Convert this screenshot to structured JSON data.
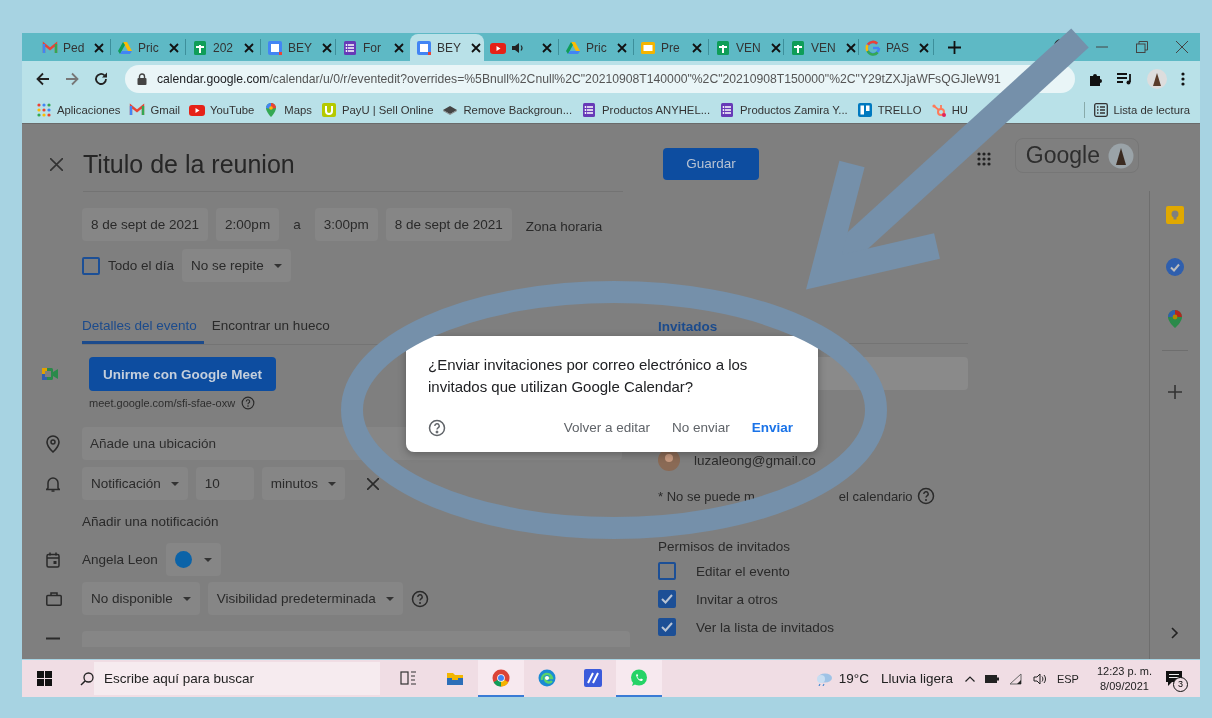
{
  "browser": {
    "tabs": [
      {
        "kind": "gmail",
        "label": "Ped",
        "selected": false
      },
      {
        "kind": "drive",
        "label": "Pric",
        "selected": false
      },
      {
        "kind": "sheets",
        "label": "202",
        "selected": false
      },
      {
        "kind": "calendar",
        "label": "BEY",
        "selected": false
      },
      {
        "kind": "forms",
        "label": "For",
        "selected": false
      },
      {
        "kind": "calendar",
        "label": "BEY",
        "selected": true
      },
      {
        "kind": "youtube",
        "selected": false
      },
      {
        "kind": "drive",
        "label": "Pric",
        "selected": false
      },
      {
        "kind": "slides",
        "label": "Pre",
        "selected": false
      },
      {
        "kind": "sheets",
        "label": "VEN",
        "selected": false
      },
      {
        "kind": "sheets",
        "label": "VEN",
        "selected": false
      },
      {
        "kind": "google",
        "label": "PAS",
        "selected": false
      }
    ],
    "url": {
      "domain": "calendar.google.com",
      "path": "/calendar/u/0/r/eventedit?overrides=%5Bnull%2Cnull%2C\"20210908T140000\"%2C\"20210908T150000\"%2C\"Y29tZXJjaWFsQGJleW91"
    },
    "bookmarks": [
      {
        "kind": "apps",
        "label": "Aplicaciones"
      },
      {
        "kind": "gmail",
        "label": "Gmail"
      },
      {
        "kind": "youtube",
        "label": "YouTube"
      },
      {
        "kind": "maps",
        "label": "Maps"
      },
      {
        "kind": "payu",
        "label": "PayU | Sell Online"
      },
      {
        "kind": "diamond",
        "label": "Remove Backgroun..."
      },
      {
        "kind": "forms",
        "label": "Productos ANYHEL..."
      },
      {
        "kind": "forms",
        "label": "Productos Zamira Y..."
      },
      {
        "kind": "trello",
        "label": "TRELLO"
      },
      {
        "kind": "hubspot",
        "label": "HU"
      }
    ],
    "reading_list": "Lista de lectura"
  },
  "event": {
    "title": "Titulo de la reunion",
    "save": "Guardar",
    "account_logo": "Google",
    "when": [
      {
        "kind": "chip",
        "text": "8 de sept de 2021"
      },
      {
        "kind": "chip",
        "text": "2:00pm"
      },
      {
        "kind": "plain",
        "text": "a"
      },
      {
        "kind": "chip",
        "text": "3:00pm"
      },
      {
        "kind": "chip",
        "text": "8 de sept de 2021"
      },
      {
        "kind": "link",
        "text": "Zona horaria"
      }
    ],
    "all_day": {
      "label": "Todo el día",
      "checked": false
    },
    "repeat": "No se repite",
    "tabs": [
      {
        "label": "Detalles del evento",
        "selected": true
      },
      {
        "label": "Encontrar un hueco",
        "selected": false
      }
    ],
    "meet_button": "Unirme con Google Meet",
    "meet_link": "meet.google.com/sfi-sfae-oxw",
    "location": {
      "placeholder": "Añade una ubicación"
    },
    "notification": {
      "type": "Notificación",
      "amount": "10",
      "unit": "minutos"
    },
    "add_notification": "Añadir una notificación",
    "calendar": {
      "name": "Angela Leon",
      "color": "#0b63a8"
    },
    "availability": "No disponible",
    "visibility": "Visibilidad predeterminada",
    "guests": {
      "heading": "Invitados",
      "list": [
        {
          "email": "luzaleong@gmail.co"
        }
      ],
      "note_start": "* No se puede m",
      "note_end": "el calendario",
      "permissions_title": "Permisos de invitados",
      "permissions": [
        {
          "label": "Editar el evento",
          "checked": false
        },
        {
          "label": "Invitar a otros",
          "checked": true
        },
        {
          "label": "Ver la lista de invitados",
          "checked": true
        }
      ]
    }
  },
  "dialog": {
    "message": "¿Enviar invitaciones por correo electrónico a los invitados que utilizan Google Calendar?",
    "buttons": [
      {
        "label": "Volver a editar",
        "kind": "text"
      },
      {
        "label": "No enviar",
        "kind": "text"
      },
      {
        "label": "Enviar",
        "kind": "primary"
      }
    ]
  },
  "taskbar": {
    "search": {
      "placeholder": "Escribe aquí para buscar"
    },
    "apps": [
      {
        "kind": "taskview",
        "running": false
      },
      {
        "kind": "explorer",
        "running": false
      },
      {
        "kind": "chrome",
        "running": true
      },
      {
        "kind": "edge",
        "running": false
      },
      {
        "kind": "mail",
        "running": false
      },
      {
        "kind": "whatsapp",
        "running": true
      }
    ],
    "temperature": "19°C",
    "weather": "Lluvia ligera",
    "language": "ESP",
    "time": "12:23 p. m.",
    "date": "8/09/2021",
    "notifications": "3"
  }
}
